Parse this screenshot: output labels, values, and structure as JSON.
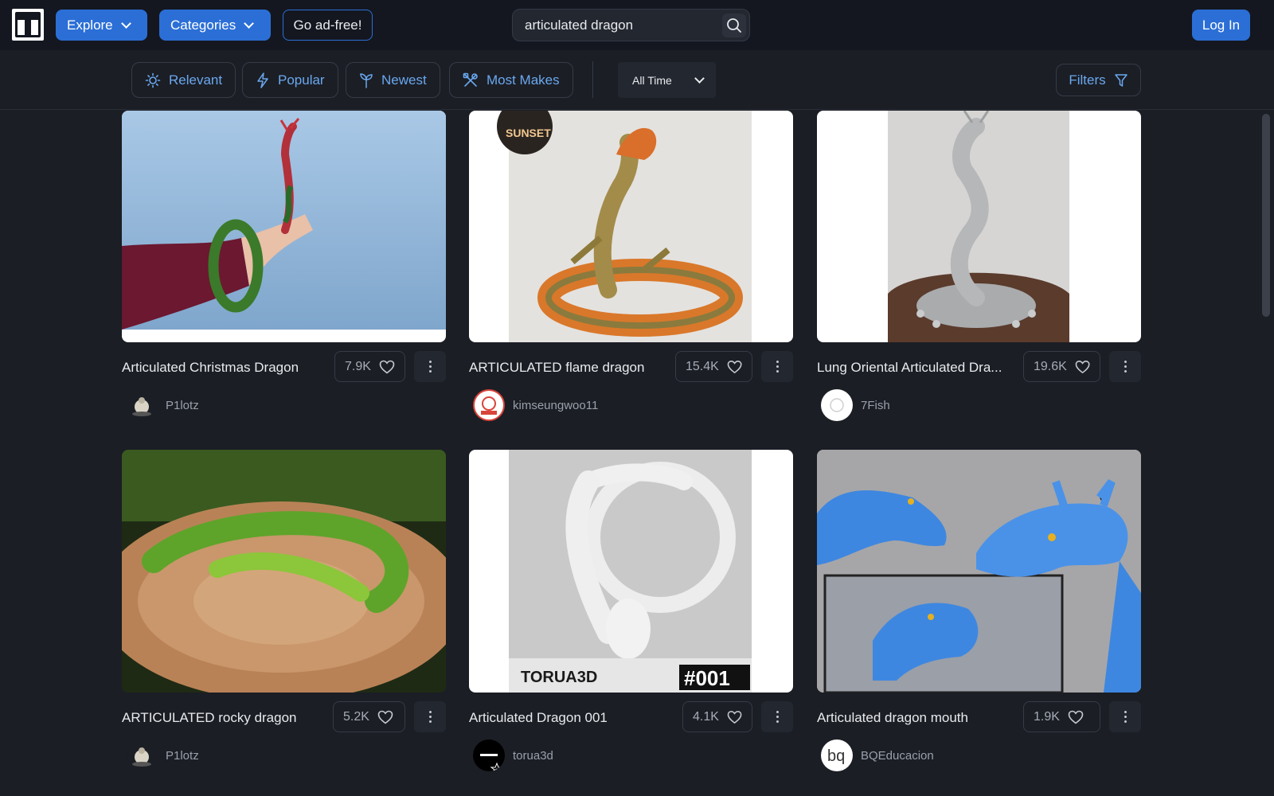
{
  "header": {
    "explore_label": "Explore",
    "categories_label": "Categories",
    "adfree_label": "Go ad-free!",
    "search_value": "articulated dragon",
    "login_label": "Log In"
  },
  "sort": {
    "relevant": "Relevant",
    "popular": "Popular",
    "newest": "Newest",
    "most_makes": "Most Makes",
    "time_range": "All Time",
    "filters": "Filters"
  },
  "cards": [
    {
      "title": "Articulated Christmas Dragon",
      "likes": "7.9K",
      "author": "P1lotz"
    },
    {
      "title": "ARTICULATED flame dragon",
      "likes": "15.4K",
      "author": "kimseungwoo11"
    },
    {
      "title": "Lung Oriental Articulated Dra...",
      "likes": "19.6K",
      "author": "7Fish"
    },
    {
      "title": "ARTICULATED rocky dragon",
      "likes": "5.2K",
      "author": "P1lotz"
    },
    {
      "title": "Articulated Dragon 001",
      "likes": "4.1K",
      "author": "torua3d"
    },
    {
      "title": "Articulated dragon mouth",
      "likes": "1.9K",
      "author": "BQEducacion"
    }
  ],
  "image_text": {
    "sunset": "SUNSET",
    "torua": "TORUA3D",
    "number": "#001",
    "bq": "bq"
  },
  "colors": {
    "accent": "#2b6fd6",
    "link": "#6aa8ef",
    "background": "#1b1e25",
    "topbar": "#141720"
  },
  "icons": {
    "search": "search-icon",
    "heart": "heart-icon",
    "more": "more-vertical-icon",
    "filter": "filter-icon"
  }
}
